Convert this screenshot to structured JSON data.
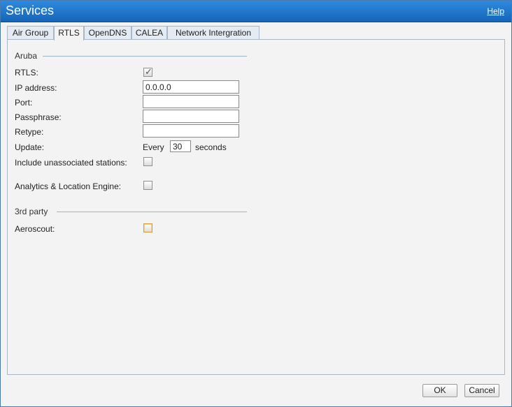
{
  "window": {
    "title": "Services",
    "help_label": "Help"
  },
  "tabs": [
    {
      "label": "Air Group"
    },
    {
      "label": "RTLS"
    },
    {
      "label": "OpenDNS"
    },
    {
      "label": "CALEA"
    },
    {
      "label": "Network Intergration"
    }
  ],
  "active_tab": "RTLS",
  "aruba": {
    "section_label": "Aruba",
    "rtls_label": "RTLS:",
    "rtls_checked": true,
    "ip_label": "IP address:",
    "ip_value": "0.0.0.0",
    "port_label": "Port:",
    "port_value": "",
    "passphrase_label": "Passphrase:",
    "passphrase_value": "",
    "retype_label": "Retype:",
    "retype_value": "",
    "update_label": "Update:",
    "update_prefix": "Every",
    "update_value": "30",
    "update_suffix": "seconds",
    "unassoc_label": "Include unassociated stations:",
    "unassoc_checked": false,
    "ale_label": "Analytics & Location Engine:",
    "ale_checked": false
  },
  "third_party": {
    "section_label": "3rd party",
    "aeroscout_label": "Aeroscout:",
    "aeroscout_checked": false
  },
  "buttons": {
    "ok": "OK",
    "cancel": "Cancel"
  }
}
